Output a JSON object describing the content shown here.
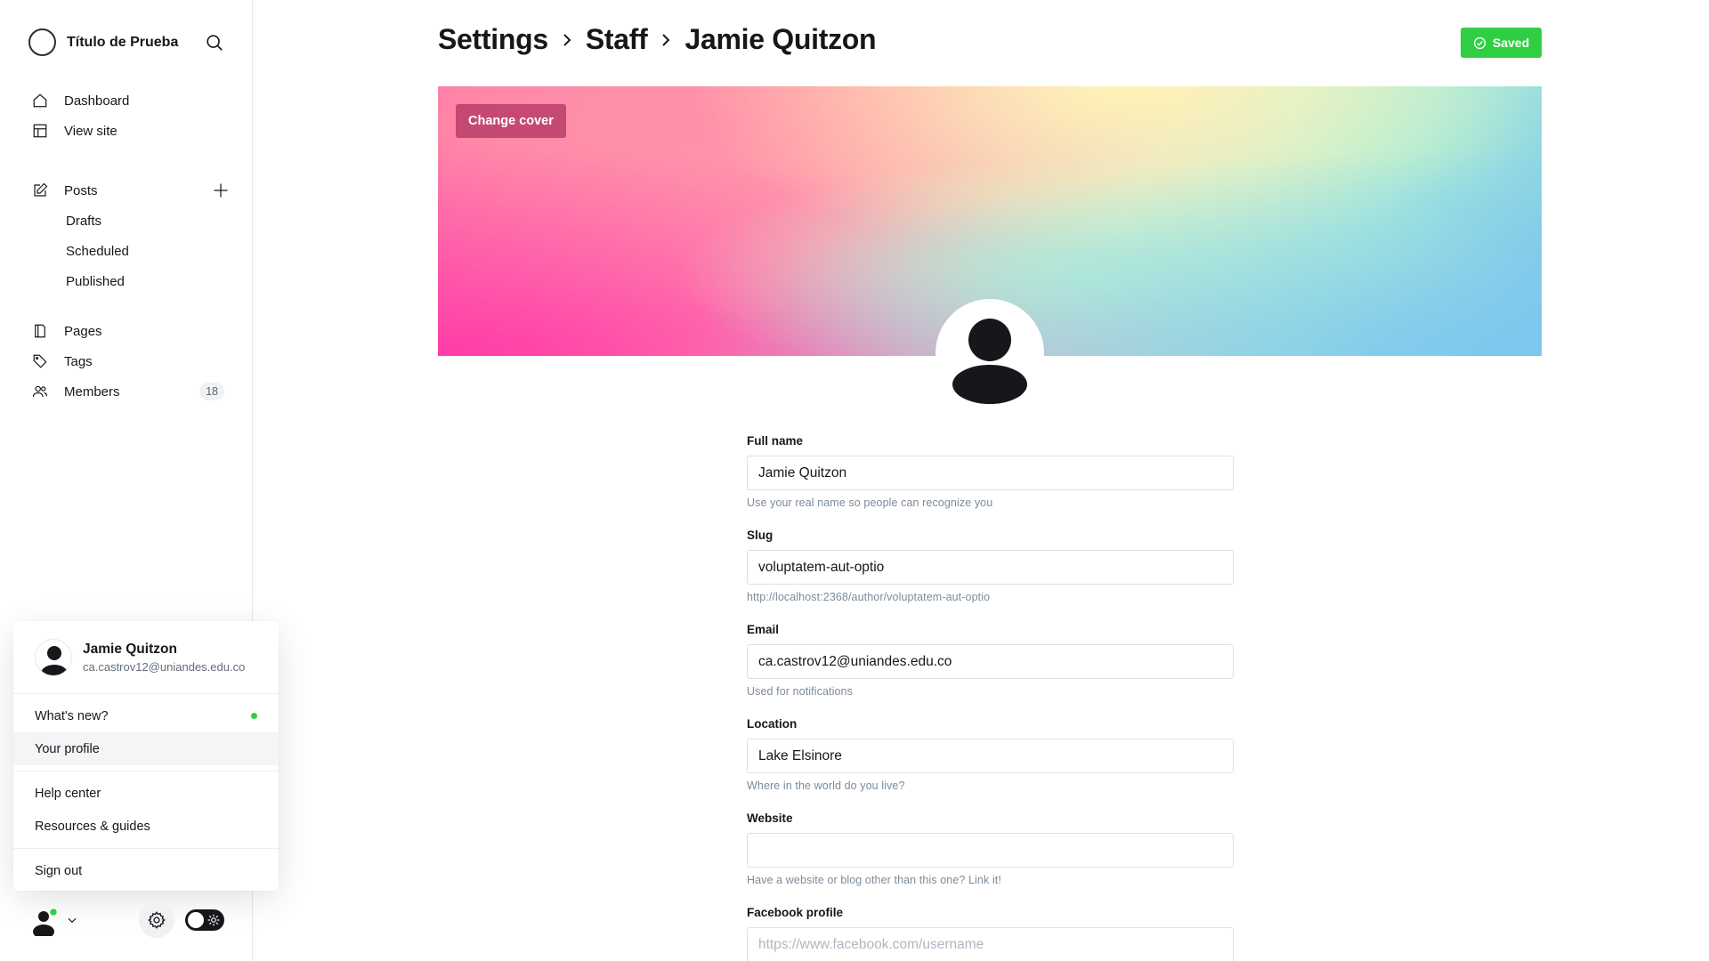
{
  "sidebar": {
    "brand_name": "Título de Prueba",
    "nav_primary": [
      {
        "label": "Dashboard",
        "icon": "home-icon"
      },
      {
        "label": "View site",
        "icon": "layout-icon"
      }
    ],
    "posts": {
      "label": "Posts",
      "sub": [
        "Drafts",
        "Scheduled",
        "Published"
      ]
    },
    "nav_secondary": [
      {
        "label": "Pages",
        "icon": "pages-icon"
      },
      {
        "label": "Tags",
        "icon": "tag-icon"
      },
      {
        "label": "Members",
        "icon": "members-icon",
        "count": "18"
      }
    ]
  },
  "user_menu": {
    "name": "Jamie Quitzon",
    "email": "ca.castrov12@uniandes.edu.co",
    "items": [
      "What's new?",
      "Your profile",
      "Help center",
      "Resources & guides",
      "Sign out"
    ]
  },
  "header": {
    "crumbs": [
      "Settings",
      "Staff",
      "Jamie Quitzon"
    ],
    "saved_label": "Saved"
  },
  "cover": {
    "change_label": "Change cover"
  },
  "form": {
    "full_name": {
      "label": "Full name",
      "value": "Jamie Quitzon",
      "hint": "Use your real name so people can recognize you"
    },
    "slug": {
      "label": "Slug",
      "value": "voluptatem-aut-optio",
      "hint": "http://localhost:2368/author/voluptatem-aut-optio"
    },
    "email": {
      "label": "Email",
      "value": "ca.castrov12@uniandes.edu.co",
      "hint": "Used for notifications"
    },
    "location": {
      "label": "Location",
      "value": "Lake Elsinore",
      "hint": "Where in the world do you live?"
    },
    "website": {
      "label": "Website",
      "value": "",
      "hint": "Have a website or blog other than this one? Link it!"
    },
    "facebook": {
      "label": "Facebook profile",
      "placeholder": "https://www.facebook.com/username"
    }
  },
  "colors": {
    "accent_green": "#30cf43",
    "text": "#15171a",
    "muted": "#7c8b9a"
  }
}
